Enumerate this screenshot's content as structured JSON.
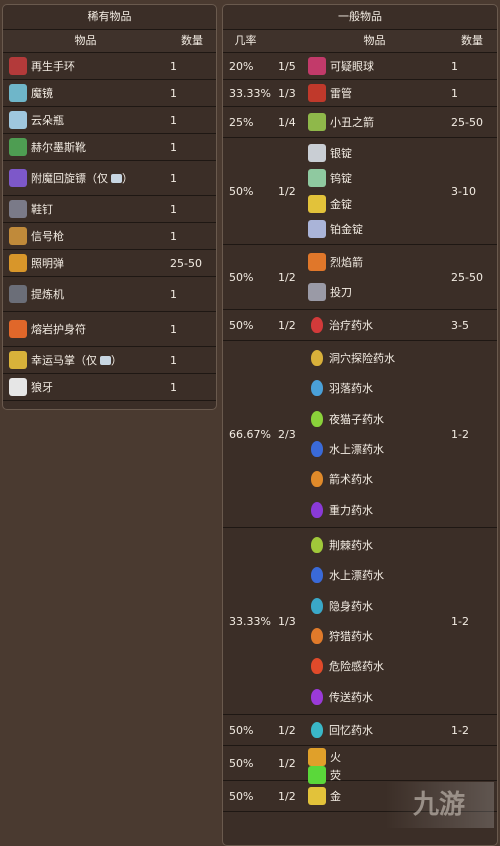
{
  "rare": {
    "title": "稀有物品",
    "headers": {
      "item": "物品",
      "qty": "数量"
    },
    "rows": [
      {
        "icon": "regeneration-band-icon",
        "color": "#b33a3a",
        "name": "再生手环",
        "qty": "1"
      },
      {
        "icon": "magic-mirror-icon",
        "color": "#6fb6c9",
        "name": "魔镜",
        "qty": "1"
      },
      {
        "icon": "cloud-bottle-icon",
        "color": "#9fc7de",
        "name": "云朵瓶",
        "qty": "1"
      },
      {
        "icon": "hermes-boots-icon",
        "color": "#4e9d52",
        "name": "赫尔墨斯靴",
        "qty": "1"
      },
      {
        "icon": "enchanted-boomerang-icon",
        "color": "#7d58c9",
        "name": "附魔回旋镖（仅",
        "qty": "1",
        "suffix": "）"
      },
      {
        "icon": "shoe-spikes-icon",
        "color": "#7a7a88",
        "name": "鞋钉",
        "qty": "1"
      },
      {
        "icon": "flare-gun-icon",
        "color": "#c08a3a",
        "name": "信号枪",
        "qty": "1"
      },
      {
        "icon": "flare-icon",
        "color": "#d8962a",
        "name": "照明弹",
        "qty": "25-50"
      },
      {
        "icon": "extractinator-icon",
        "color": "#6b6e78",
        "name": "提炼机",
        "qty": "1"
      },
      {
        "icon": "lava-charm-icon",
        "color": "#e0672a",
        "name": "熔岩护身符",
        "qty": "1"
      },
      {
        "icon": "lucky-horseshoe-icon",
        "color": "#d8b23a",
        "name": "幸运马掌（仅",
        "qty": "1",
        "suffix": "）"
      },
      {
        "icon": "shark-tooth-icon",
        "color": "#e6e6e6",
        "name": "狼牙",
        "qty": "1"
      }
    ]
  },
  "common": {
    "title": "一般物品",
    "headers": {
      "rate": "几率",
      "item": "物品",
      "qty": "数量"
    },
    "groups": [
      {
        "rate": "20%",
        "frac": "1/5",
        "qty": "1",
        "items": [
          {
            "icon": "suspicious-eye-icon",
            "color": "#c23a6a",
            "name": "可疑眼球"
          }
        ]
      },
      {
        "rate": "33.33%",
        "frac": "1/3",
        "qty": "1",
        "items": [
          {
            "icon": "dynamite-icon",
            "color": "#c0392b",
            "name": "雷管"
          }
        ]
      },
      {
        "rate": "25%",
        "frac": "1/4",
        "qty": "25-50",
        "items": [
          {
            "icon": "jesters-arrow-icon",
            "color": "#8fb84a",
            "name": "小丑之箭"
          }
        ]
      },
      {
        "rate": "50%",
        "frac": "1/2",
        "qty": "3-10",
        "items": [
          {
            "icon": "silver-bar-icon",
            "color": "#c9ced4",
            "name": "银锭"
          },
          {
            "icon": "tungsten-bar-icon",
            "color": "#8fc9a0",
            "name": "钨锭"
          },
          {
            "icon": "gold-bar-icon",
            "color": "#e2c23a",
            "name": "金锭"
          },
          {
            "icon": "platinum-bar-icon",
            "color": "#aab4d8",
            "name": "铂金锭"
          }
        ]
      },
      {
        "rate": "50%",
        "frac": "1/2",
        "qty": "25-50",
        "items": [
          {
            "icon": "flaming-arrow-icon",
            "color": "#e0772a",
            "name": "烈焰箭"
          },
          {
            "icon": "throwing-knife-icon",
            "color": "#9a9aa6",
            "name": "投刀"
          }
        ]
      },
      {
        "rate": "50%",
        "frac": "1/2",
        "qty": "3-5",
        "items": [
          {
            "icon": "healing-potion-icon",
            "color": "#d23a3a",
            "name": "治疗药水"
          }
        ]
      },
      {
        "rate": "66.67%",
        "frac": "2/3",
        "qty": "1-2",
        "items": [
          {
            "icon": "spelunker-potion-icon",
            "color": "#d8b03a",
            "name": "洞穴探险药水"
          },
          {
            "icon": "featherfall-potion-icon",
            "color": "#4aa0d8",
            "name": "羽落药水"
          },
          {
            "icon": "night-owl-potion-icon",
            "color": "#8ad23a",
            "name": "夜猫子药水"
          },
          {
            "icon": "water-walking-potion-icon",
            "color": "#3a6ad8",
            "name": "水上漂药水"
          },
          {
            "icon": "archery-potion-icon",
            "color": "#e08a2a",
            "name": "箭术药水"
          },
          {
            "icon": "gravitation-potion-icon",
            "color": "#8a3ad8",
            "name": "重力药水"
          }
        ]
      },
      {
        "rate": "33.33%",
        "frac": "1/3",
        "qty": "1-2",
        "items": [
          {
            "icon": "thorns-potion-icon",
            "color": "#a0c83a",
            "name": "荆棘药水"
          },
          {
            "icon": "water-walking-potion-icon",
            "color": "#3a6ad8",
            "name": "水上漂药水"
          },
          {
            "icon": "invisibility-potion-icon",
            "color": "#3aa8c8",
            "name": "隐身药水"
          },
          {
            "icon": "hunter-potion-icon",
            "color": "#e07a2a",
            "name": "狩猎药水"
          },
          {
            "icon": "dangersense-potion-icon",
            "color": "#e04a2a",
            "name": "危险感药水"
          },
          {
            "icon": "teleportation-potion-icon",
            "color": "#9a3ad8",
            "name": "传送药水"
          }
        ]
      },
      {
        "rate": "50%",
        "frac": "1/2",
        "qty": "1-2",
        "items": [
          {
            "icon": "recall-potion-icon",
            "color": "#3ab8c8",
            "name": "回忆药水"
          }
        ]
      },
      {
        "rate": "50%",
        "frac": "1/2",
        "qty": "",
        "items": [
          {
            "icon": "torch-icon",
            "color": "#e0a02a",
            "name": "火"
          },
          {
            "icon": "glowstick-icon",
            "color": "#5ad83a",
            "name": "荧"
          }
        ]
      },
      {
        "rate": "50%",
        "frac": "1/2",
        "qty": "",
        "items": [
          {
            "icon": "gold-coin-icon",
            "color": "#e2c23a",
            "name": "金"
          }
        ]
      }
    ]
  },
  "watermark": "九游"
}
